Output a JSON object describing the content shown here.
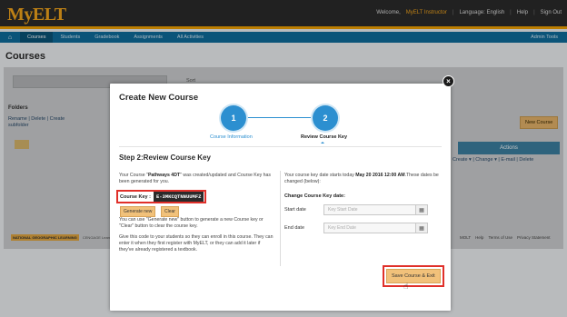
{
  "app": {
    "logo_text": "MyELT"
  },
  "topbar": {
    "welcome": "Welcome,",
    "user": "MyELT Instructor",
    "language": "Language: English",
    "help": "Help",
    "sign_out": "Sign Out"
  },
  "nav": {
    "tabs": [
      "Courses",
      "Students",
      "Gradebook",
      "Assignments",
      "All Activities"
    ],
    "active": "Courses",
    "admin": "Admin Tools"
  },
  "page": {
    "title": "Courses",
    "sort": "Sort",
    "folders": "Folders",
    "folder_links": "Rename | Delete | Create subfolder",
    "new_course": "New Course",
    "actions": "Actions",
    "action_links": "Create ▾ | Change ▾ | E-mail | Delete"
  },
  "footer": {
    "links": [
      "MOLT",
      "Help",
      "Terms of Use",
      "Privacy Statement"
    ],
    "publisher": "NATIONAL GEOGRAPHIC LEARNING",
    "publisher2": "CENGAGE Learning",
    "copyright": "© 2016"
  },
  "modal": {
    "title": "Create New Course",
    "steps": [
      {
        "num": "1",
        "label": "Course Information"
      },
      {
        "num": "2",
        "label": "Review Course Key"
      }
    ],
    "step_heading": "Step 2:Review Course Key",
    "intro_prefix": "Your Course \"",
    "course_name": "Pathways 4DT",
    "intro_suffix": "\" was created/updated and Course Key has been generated for you.",
    "course_key_label": "Course Key :",
    "course_key": "E-3MKCQTNNUUMFZ",
    "generate_button": "Generate new",
    "clear_button": "Clear",
    "help_text_1": "You can use \"Generate new\" button to generate a new Course key or \"Clear\" button to clear the course key.",
    "help_text_2": "Give this code to your students so they can enroll in this course. They can enter it when they first register with MyELT, or they can add it later if they've already registered a textbook.",
    "date_intro_prefix": "Your course key date starts today ",
    "date_value": "May 20 2016 12:00 AM",
    "date_intro_suffix": ".These dates be changed (below):",
    "change_title": "Change Course Key date:",
    "start_label": "Start date",
    "start_placeholder": "Key Start Date",
    "end_label": "End date",
    "end_placeholder": "Key End Date",
    "save_button": "Save Course & Exit",
    "close": "×"
  }
}
